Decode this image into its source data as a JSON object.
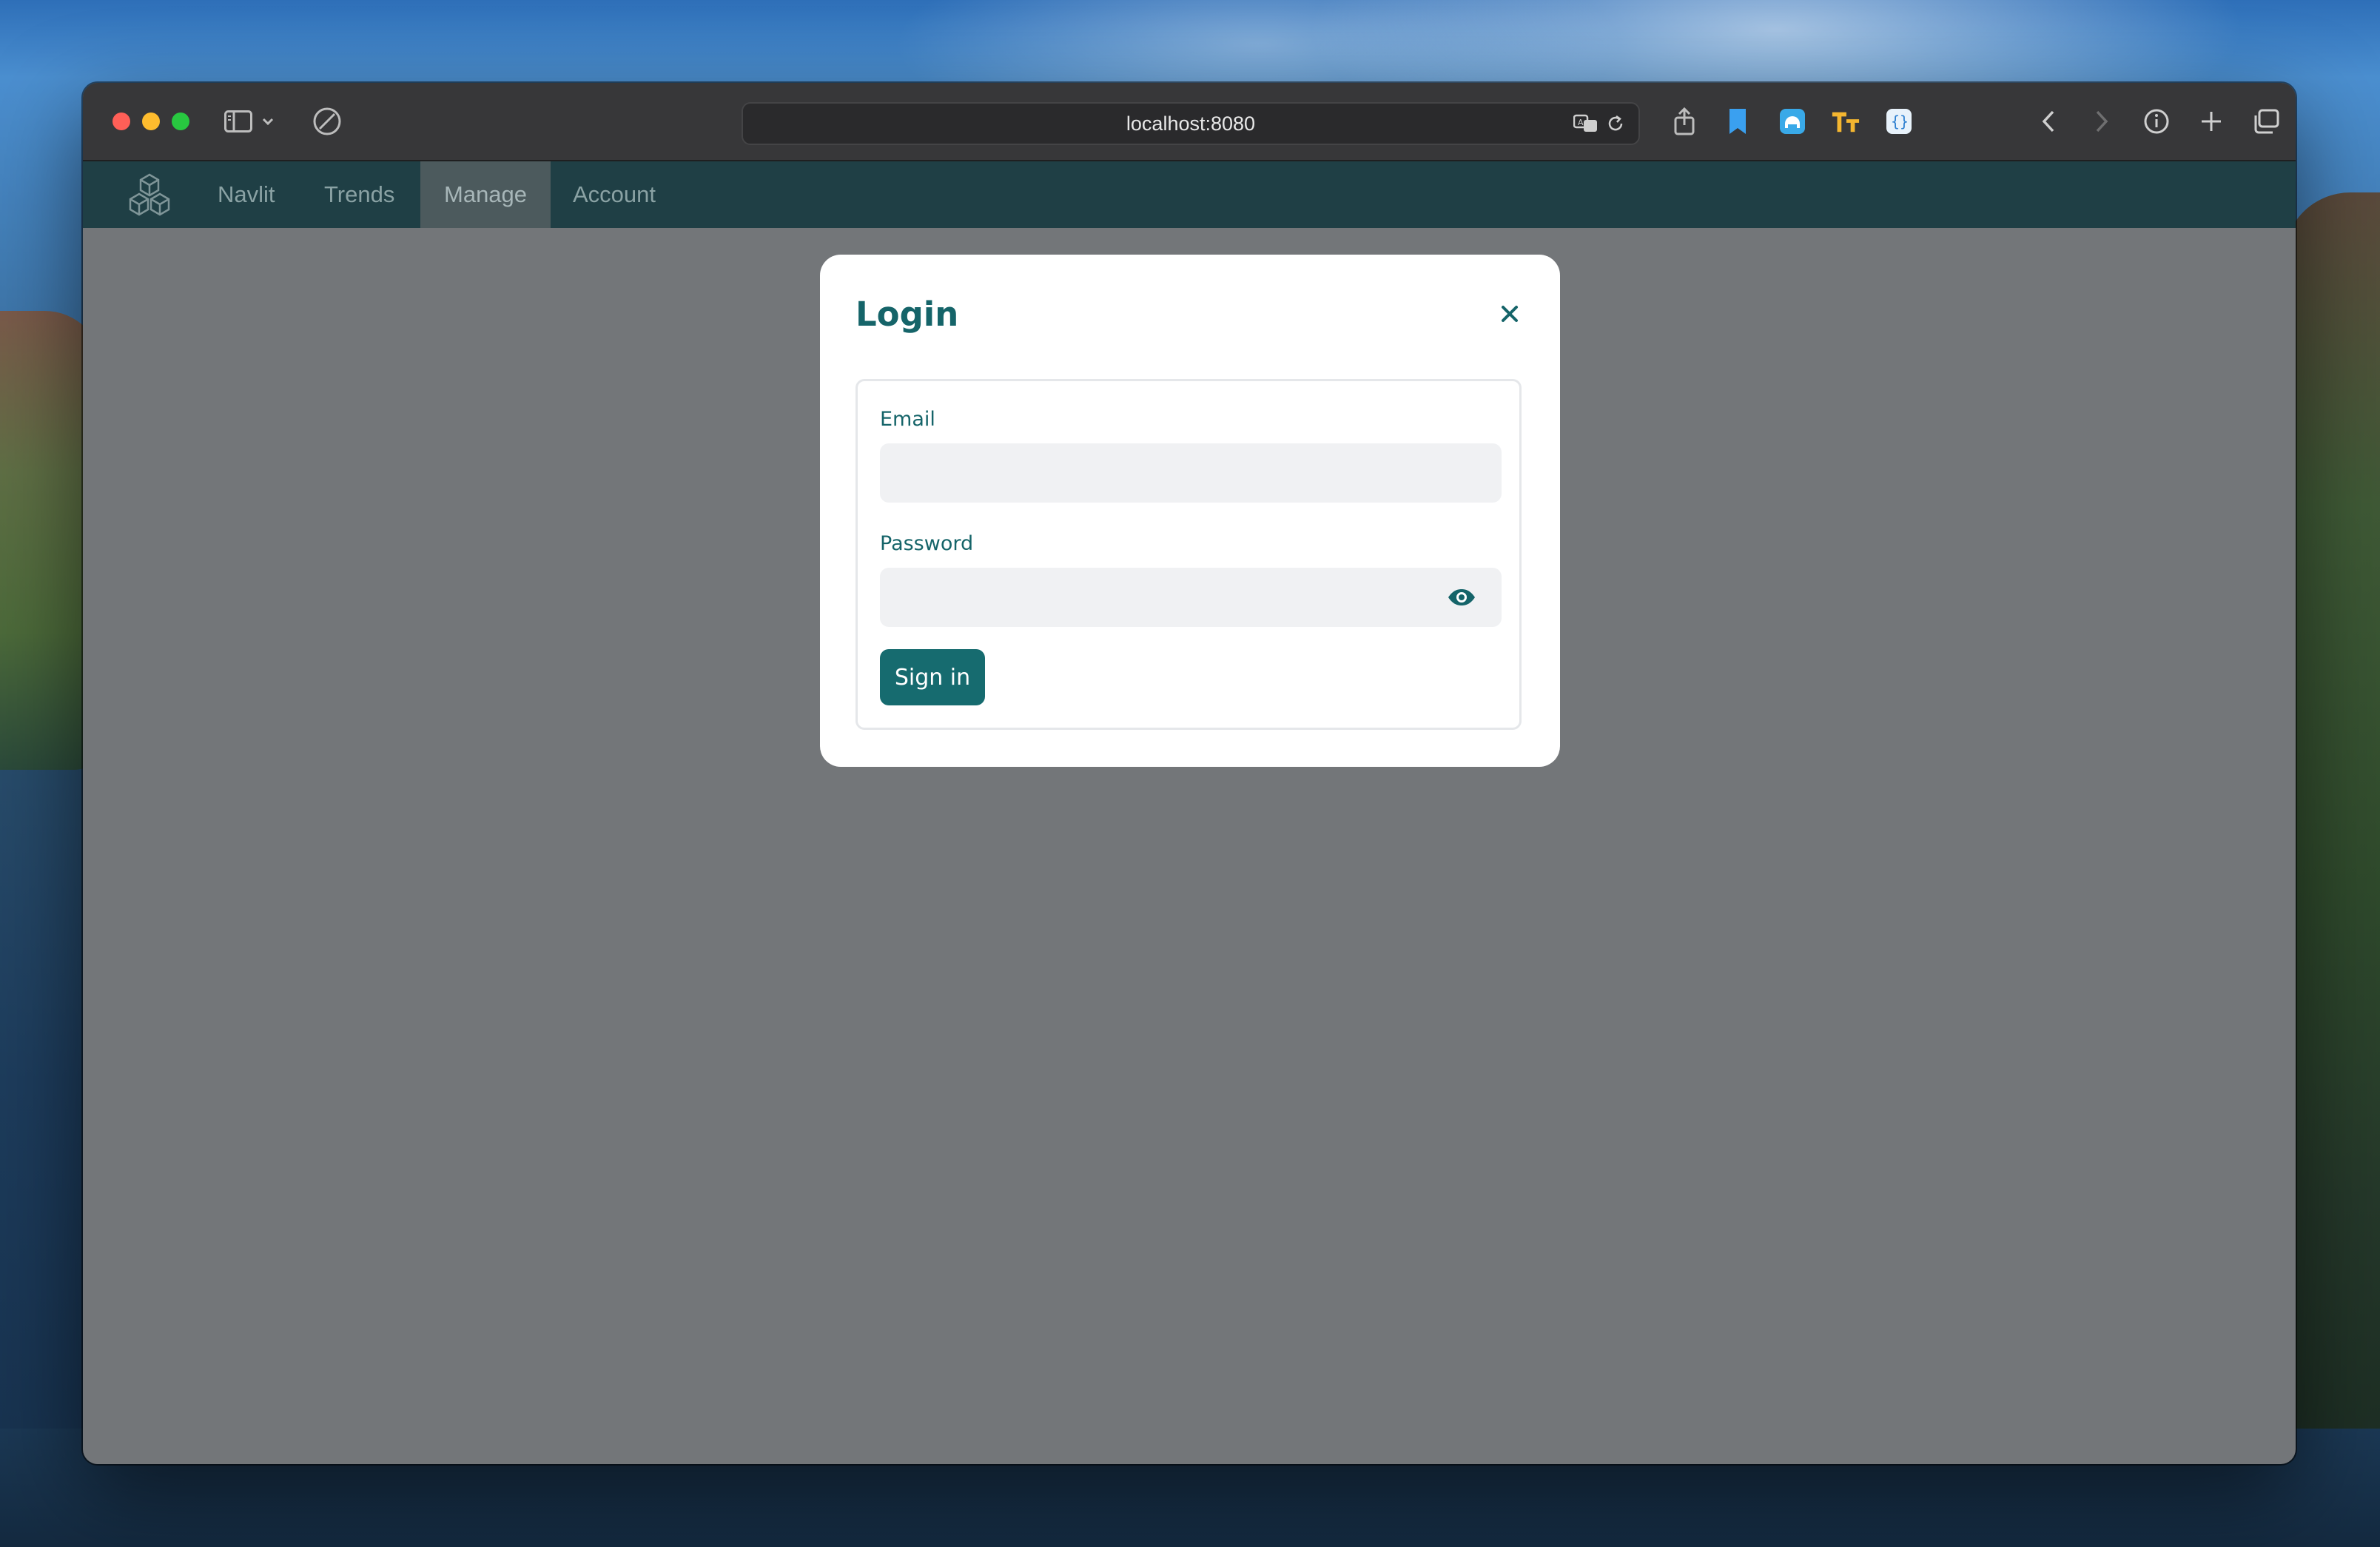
{
  "browser": {
    "url": "localhost:8080"
  },
  "icons": {
    "sidebar": "sidebar-icon",
    "chevron": "chevron-down-icon",
    "privacy": "no-entry-icon",
    "translate": "translate-icon",
    "reload": "reload-icon",
    "share": "share-icon",
    "bookmark": "bookmark-icon",
    "extension": "extension-icon",
    "text_size": "text-size-icon",
    "brackets": "brackets-icon",
    "back": "back-icon",
    "forward": "forward-icon",
    "info": "info-icon",
    "new_tab": "plus-icon",
    "tabs": "tabs-overview-icon"
  },
  "nav": {
    "items": [
      {
        "label": "Navlit"
      },
      {
        "label": "Trends"
      },
      {
        "label": "Manage"
      },
      {
        "label": "Account"
      }
    ],
    "active": "Manage"
  },
  "modal": {
    "title": "Login",
    "email_label": "Email",
    "email_value": "",
    "password_label": "Password",
    "password_value": "",
    "submit_label": "Sign in"
  },
  "colors": {
    "accent": "#166b6f",
    "navbar": "#1f3f45",
    "overlay": "#737679"
  }
}
